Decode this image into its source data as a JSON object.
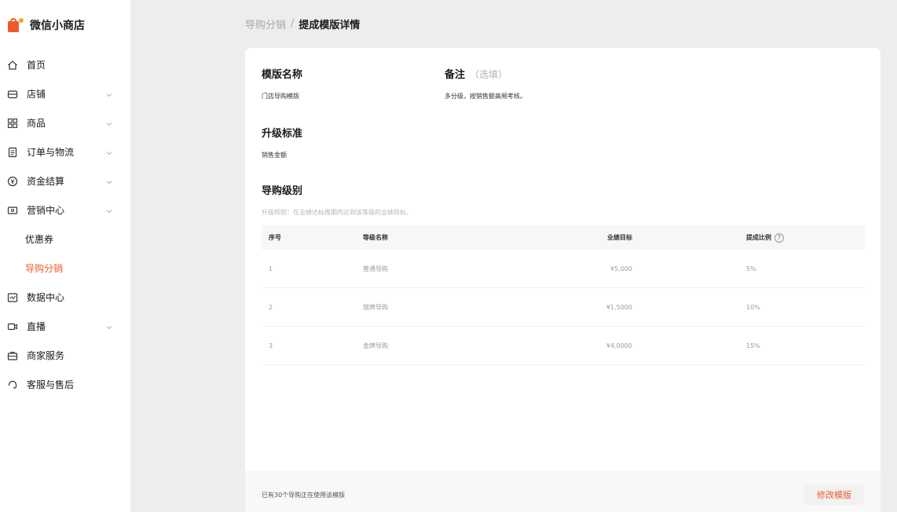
{
  "brand": {
    "name": "微信小商店"
  },
  "sidebar": {
    "items": [
      {
        "label": "首页",
        "icon": "home-icon",
        "expandable": false
      },
      {
        "label": "店铺",
        "icon": "shop-icon",
        "expandable": true
      },
      {
        "label": "商品",
        "icon": "grid-icon",
        "expandable": true
      },
      {
        "label": "订单与物流",
        "icon": "clipboard-icon",
        "expandable": true
      },
      {
        "label": "资金结算",
        "icon": "yen-icon",
        "expandable": true
      },
      {
        "label": "营销中心",
        "icon": "coupon-icon",
        "expandable": true
      },
      {
        "label": "优惠券",
        "sub": true
      },
      {
        "label": "导购分销",
        "sub": true,
        "active": true
      },
      {
        "label": "数据中心",
        "icon": "chart-icon",
        "expandable": false
      },
      {
        "label": "直播",
        "icon": "video-icon",
        "expandable": true
      },
      {
        "label": "商家服务",
        "icon": "briefcase-icon",
        "expandable": false
      },
      {
        "label": "客服与售后",
        "icon": "headset-icon",
        "expandable": false
      }
    ]
  },
  "breadcrumb": {
    "parent": "导购分销",
    "separator": "/",
    "current": "提成模版详情"
  },
  "detail": {
    "template_name_label": "模版名称",
    "template_name_value": "门店导购模版",
    "note_label": "备注",
    "note_optional": "（选填）",
    "note_value": "多分级，按销售额高频考核。",
    "upgrade_label": "升级标准",
    "upgrade_value": "销售金额",
    "level_label": "导购级别",
    "level_hint": "升级规则：在业绩达标周期内达到该等级的业绩目标。"
  },
  "table": {
    "headers": {
      "index": "序号",
      "level_name": "等级名称",
      "target": "业绩目标",
      "ratio": "提成比例"
    },
    "rows": [
      {
        "index": "1",
        "level_name": "普通导购",
        "target": "¥5,000",
        "ratio": "5%"
      },
      {
        "index": "2",
        "level_name": "银牌导购",
        "target": "¥1,5000",
        "ratio": "10%"
      },
      {
        "index": "3",
        "level_name": "金牌导购",
        "target": "¥4,0000",
        "ratio": "15%"
      }
    ]
  },
  "footer": {
    "usage_text": "已有30个导购正在使用该模版",
    "edit_label": "修改模版"
  },
  "colors": {
    "accent": "#f05a2a",
    "background": "#ededed",
    "card": "#ffffff"
  }
}
